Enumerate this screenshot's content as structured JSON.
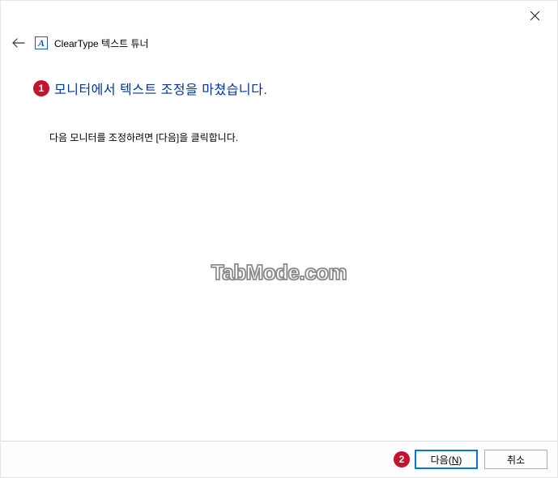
{
  "window": {
    "title": "ClearType 텍스트 튜너"
  },
  "badges": {
    "heading": "1",
    "next": "2"
  },
  "content": {
    "heading": "모니터에서 텍스트 조정을 마쳤습니다.",
    "body": "다음 모니터를 조정하려면 [다음]을 클릭합니다."
  },
  "watermark": "TabMode.com",
  "buttons": {
    "next_prefix": "다음(",
    "next_mnemonic": "N",
    "next_suffix": ")",
    "cancel": "취소"
  }
}
